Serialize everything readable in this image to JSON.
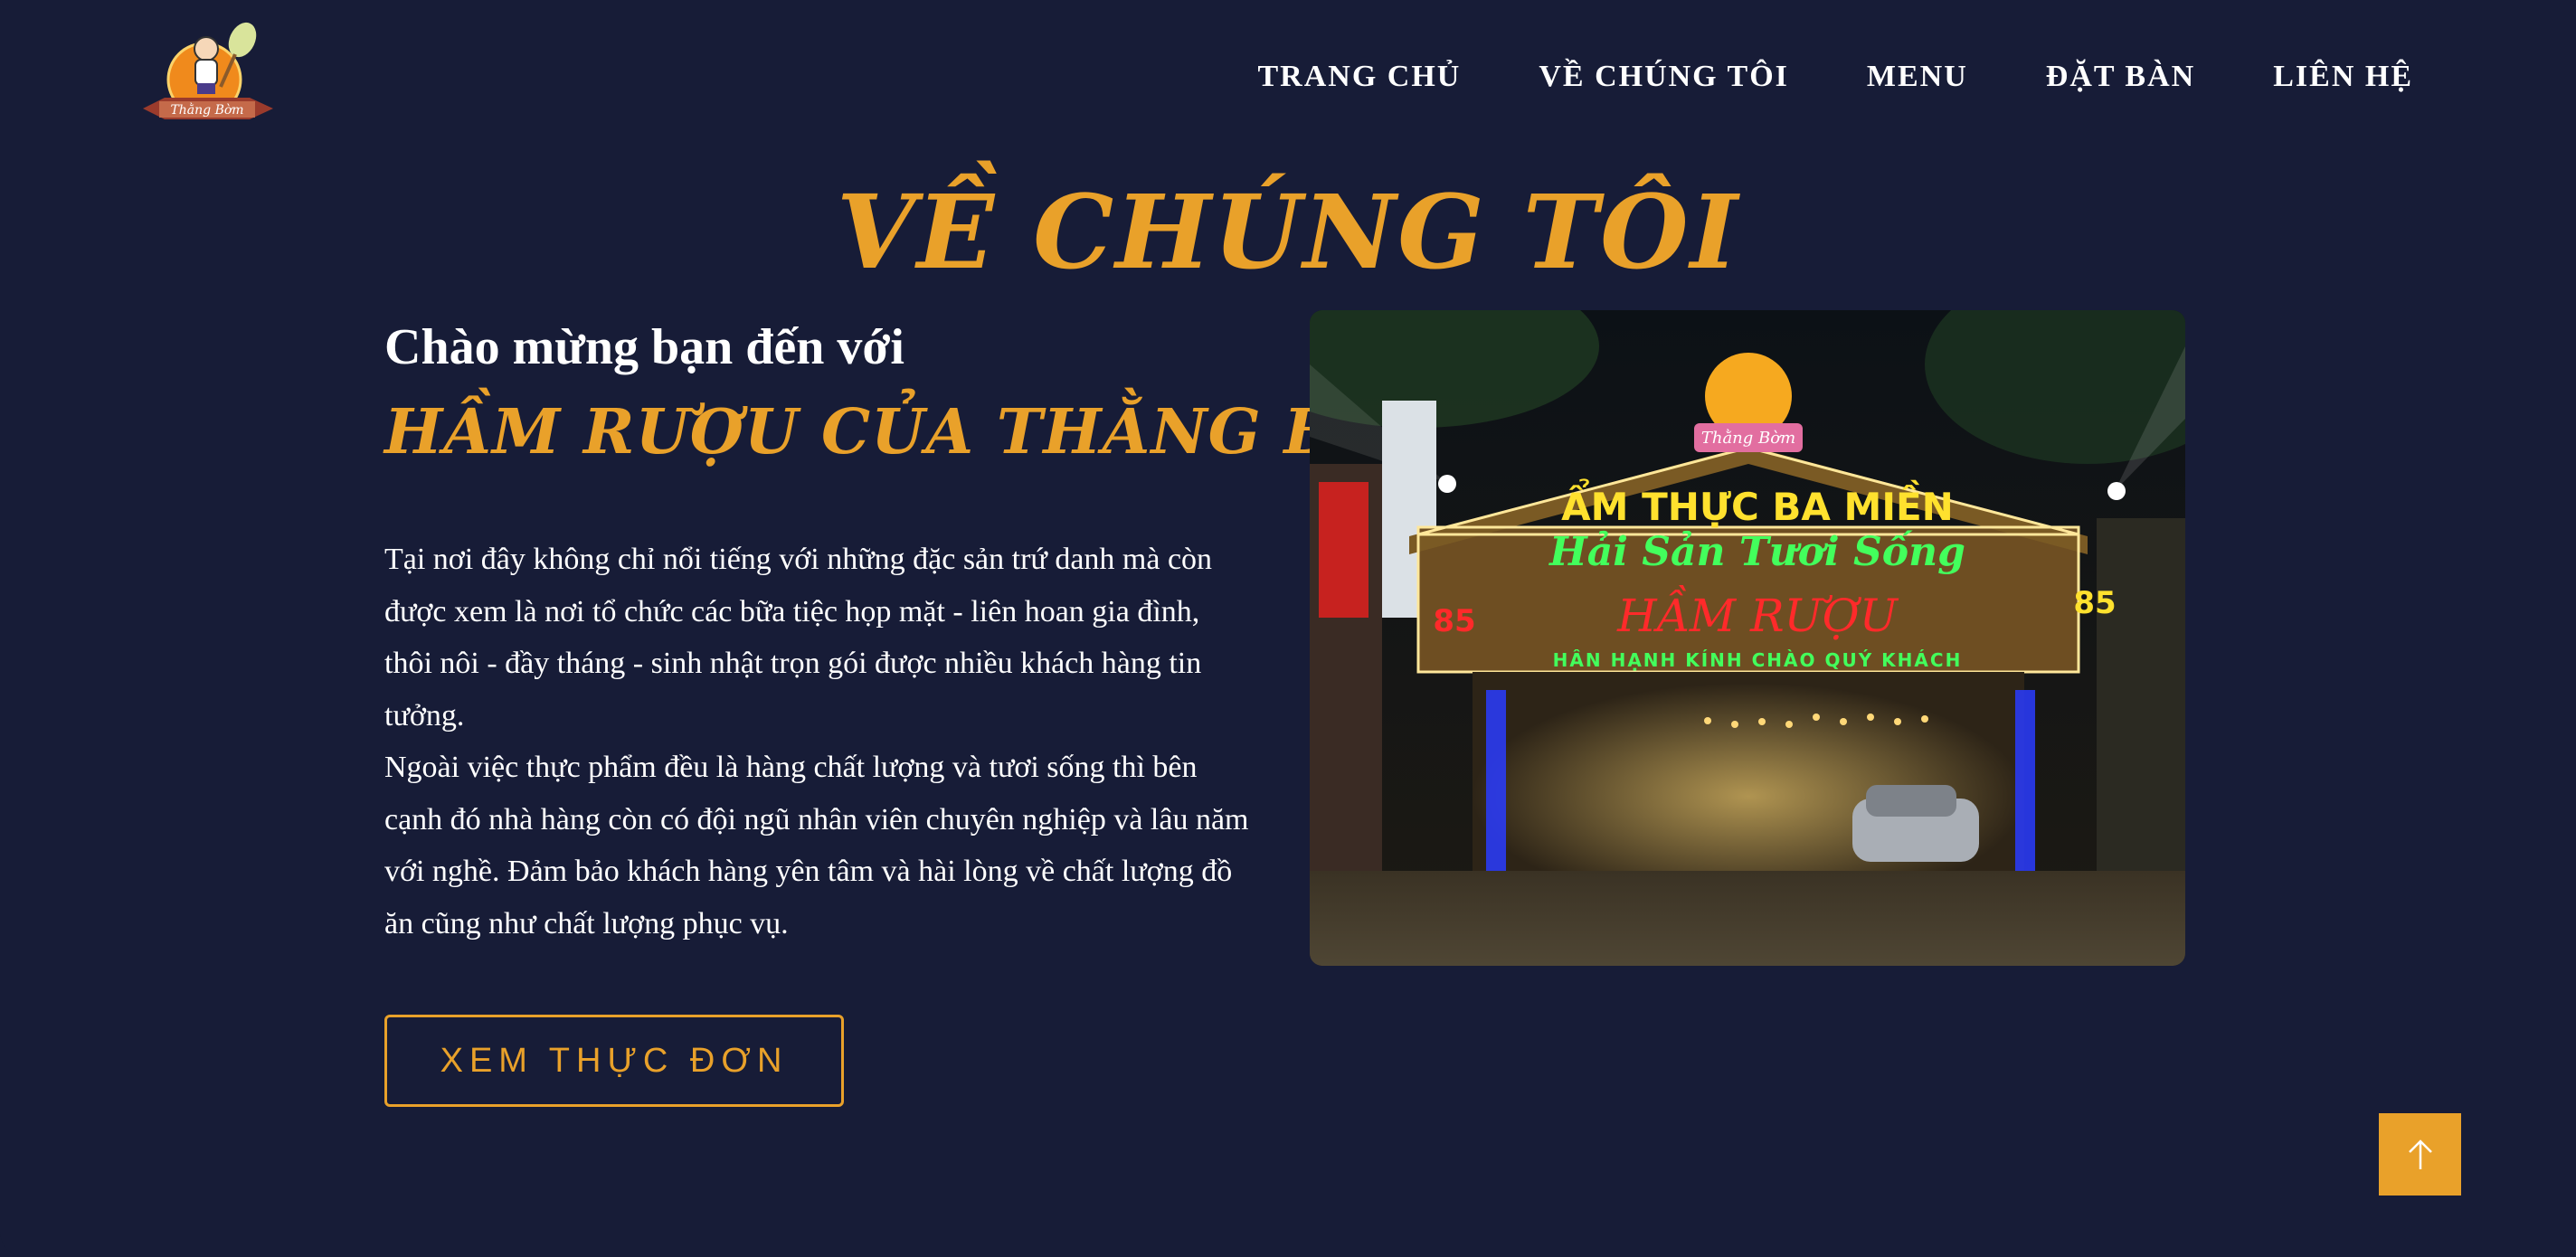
{
  "header": {
    "logo_icon": "restaurant-mascot-logo-icon",
    "nav": [
      {
        "label": "TRANG CHỦ"
      },
      {
        "label": "VỀ CHÚNG TÔI"
      },
      {
        "label": "MENU"
      },
      {
        "label": "ĐẶT BÀN"
      },
      {
        "label": "LIÊN HỆ"
      }
    ]
  },
  "about": {
    "title": "VỀ CHÚNG TÔI",
    "welcome": "Chào mừng bạn đến với",
    "brand": "HẦM RƯỢU CỦA THẰNG BỜM",
    "paragraphs": [
      "Tại nơi đây không chỉ nổi tiếng với những đặc sản trứ danh mà còn được xem là nơi tổ chức các bữa tiệc họp mặt - liên hoan gia đình, thôi nôi - đầy tháng - sinh nhật trọn gói được nhiều khách hàng tin tưởng.",
      "Ngoài việc thực phẩm đều là hàng chất lượng và tươi sống thì bên cạnh đó nhà hàng còn có đội ngũ nhân viên chuyên nghiệp và lâu năm với nghề. Đảm bảo khách hàng yên tâm và hài lòng về chất lượng đồ ăn cũng như chất lượng phục vụ."
    ],
    "cta_label": "XEM THỰC ĐƠN"
  },
  "photo": {
    "sign_top": "ẨM THỰC BA MIỀN",
    "sign_middle": "Hải Sản Tươi Sống",
    "sign_main": "HẦM RƯỢU",
    "sign_bottom": "HÂN HẠNH KÍNH CHÀO QUÝ KHÁCH",
    "house_number": "85",
    "logo_text": "Thằng Bờm"
  },
  "scroll_top_icon": "arrow-up-icon",
  "colors": {
    "background": "#171c37",
    "accent": "#e9a12a",
    "text": "#ffffff"
  }
}
